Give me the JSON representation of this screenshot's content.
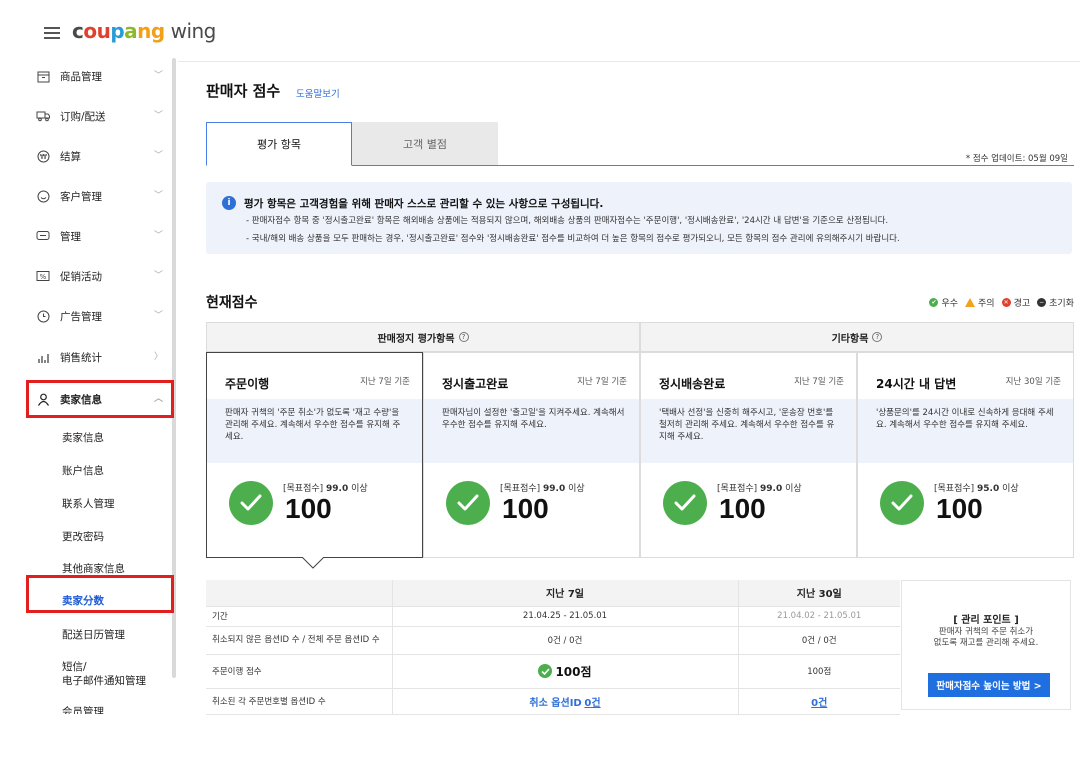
{
  "header": {
    "logo_parts": [
      "c",
      "ou",
      "p",
      "a",
      "ng"
    ],
    "logo_wing": " wing"
  },
  "sidebar": {
    "items": [
      {
        "label": "商品管理",
        "icon": "box-icon"
      },
      {
        "label": "订购/配送",
        "icon": "truck-icon"
      },
      {
        "label": "结算",
        "icon": "won-coin-icon"
      },
      {
        "label": "客户管理",
        "icon": "smile-icon"
      },
      {
        "label": "管理",
        "icon": "chat-icon"
      },
      {
        "label": "促销活动",
        "icon": "percent-icon"
      },
      {
        "label": "广告管理",
        "icon": "clock-icon"
      },
      {
        "label": "销售统计",
        "icon": "bar-chart-icon"
      },
      {
        "label": "卖家信息",
        "icon": "person-icon"
      }
    ],
    "sub_items": [
      "卖家信息",
      "账户信息",
      "联系人管理",
      "更改密码",
      "其他商家信息",
      "卖家分数",
      "配送日历管理",
      "短信/",
      "电子邮件通知管理",
      "会员管理"
    ]
  },
  "main": {
    "title": "판매자 점수",
    "help": "도움말보기",
    "tabs": [
      {
        "label": "평가 항목"
      },
      {
        "label": "고객 별점"
      }
    ],
    "update_note": "* 점수 업데이트: 05월 09일",
    "notice": {
      "title": "평가 항목은 고객경험을 위해 판매자 스스로 관리할 수 있는 사항으로 구성됩니다.",
      "line1": "- 판매자점수 항목 중 '정시출고완료' 항목은 해외배송 상품에는 적용되지 않으며, 해외배송 상품의 판매자점수는 '주문이행', '정시배송완료', '24시간 내 답변'을 기준으로 산정됩니다.",
      "line2": "- 국내/해외 배송 상품을 모두 판매하는 경우, '정시출고완료' 점수와 '정시배송완료' 점수를 비교하여 더 높은 항목의 점수로 평가되오니, 모든 항목의 점수 관리에 유의해주시기 바랍니다."
    },
    "current_title": "현재점수",
    "legend": {
      "good": "우수",
      "caution": "주의",
      "warning": "경고",
      "reset": "초기화"
    },
    "group_headers": {
      "suspension": "판매정지 평가항목",
      "other": "기타항목"
    },
    "cards": [
      {
        "title": "주문이행",
        "basis": "지난 7일 기준",
        "desc": "판매자 귀책의 '주문 취소'가 없도록 '재고 수량'을 관리해 주세요. 계속해서 우수한 점수를 유지해 주세요.",
        "target_label": "[목표점수]",
        "target": "99.0",
        "target_suffix": "이상",
        "score": "100"
      },
      {
        "title": "정시출고완료",
        "basis": "지난 7일 기준",
        "desc": "판매자님이 설정한 '출고일'을 지켜주세요. 계속해서 우수한 점수를 유지해 주세요.",
        "target_label": "[목표점수]",
        "target": "99.0",
        "target_suffix": "이상",
        "score": "100"
      },
      {
        "title": "정시배송완료",
        "basis": "지난 7일 기준",
        "desc": "'택배사 선정'을 신중히 해주시고, '운송장 번호'를 철저히 관리해 주세요. 계속해서 우수한 점수를 유지해 주세요.",
        "target_label": "[목표점수]",
        "target": "99.0",
        "target_suffix": "이상",
        "score": "100"
      },
      {
        "title": "24시간 내 답변",
        "basis": "지난 30일 기준",
        "desc": "'상품문의'를 24시간 이내로 신속하게 응대해 주세요. 계속해서 우수한 점수를 유지해 주세요.",
        "target_label": "[목표점수]",
        "target": "95.0",
        "target_suffix": "이상",
        "score": "100"
      }
    ],
    "table": {
      "headers": {
        "last7": "지난 7일",
        "last30": "지난 30일"
      },
      "rows": [
        {
          "label": "기간",
          "v7": "21.04.25 - 21.05.01",
          "v30": "21.04.02 - 21.05.01"
        },
        {
          "label": "취소되지 않은 옵션ID 수 / 전체 주문 옵션ID 수",
          "v7": "0건 / 0건",
          "v30": "0건 / 0건"
        },
        {
          "label": "주문이행 점수",
          "v7": "100점",
          "v30": "100점"
        },
        {
          "label": "취소된 각 주문번호별 옵션ID 수",
          "v7_prefix": "취소 옵션ID",
          "v7": "0건",
          "v30": "0건"
        }
      ]
    },
    "management": {
      "title": "[ 관리 포인트 ]",
      "desc1": "판매자 귀책의 주문 취소가",
      "desc2": "없도록 재고를 관리해 주세요.",
      "button": "판매자점수 높이는 방법 >"
    }
  },
  "colors": {
    "accent": "#1f6fe0",
    "good": "#4cae4c",
    "caution": "#f2a21b",
    "warning": "#e0402e",
    "highlight": "#e11f1f"
  }
}
